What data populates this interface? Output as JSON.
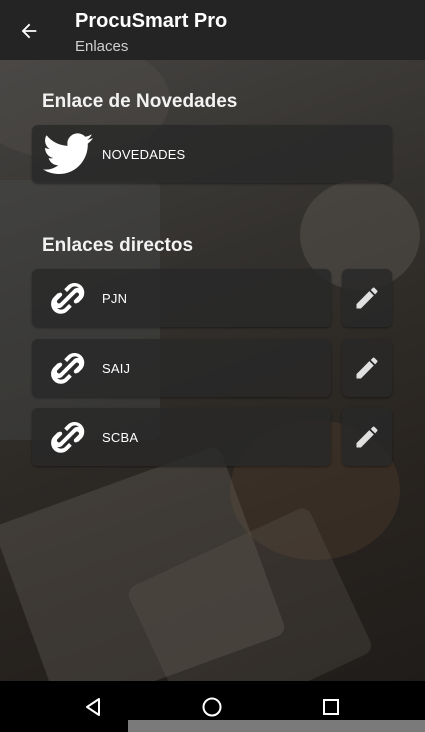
{
  "appbar": {
    "title": "ProcuSmart Pro",
    "subtitle": "Enlaces",
    "back_icon": "arrow-left-icon"
  },
  "news_section": {
    "heading": "Enlace de Novedades",
    "item": {
      "label": "NOVEDADES",
      "icon": "twitter-bird-icon"
    }
  },
  "direct_section": {
    "heading": "Enlaces directos",
    "items": [
      {
        "label": "PJN",
        "icon": "link-chain-icon",
        "edit_icon": "pencil-icon"
      },
      {
        "label": "SAIJ",
        "icon": "link-chain-icon",
        "edit_icon": "pencil-icon"
      },
      {
        "label": "SCBA",
        "icon": "link-chain-icon",
        "edit_icon": "pencil-icon"
      }
    ]
  },
  "navbar": {
    "back": "triangle-back-icon",
    "home": "circle-home-icon",
    "recents": "square-recents-icon"
  },
  "colors": {
    "appbar": "#242424",
    "card": "#282828",
    "text": "#ffffff",
    "navbar": "#000000"
  }
}
